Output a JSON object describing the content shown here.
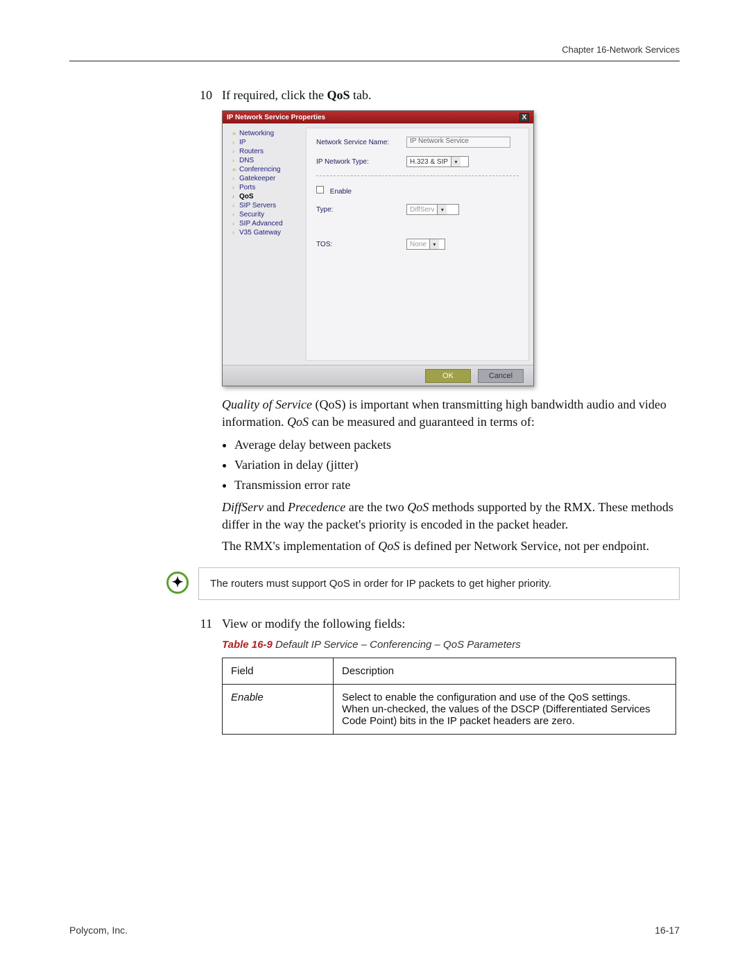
{
  "header": {
    "chapter": "Chapter 16-Network Services"
  },
  "step10": {
    "num": "10",
    "text_pre": "If required, click the ",
    "text_bold": "QoS",
    "text_post": " tab."
  },
  "dialog": {
    "title": "IP Network Service Properties",
    "close": "X",
    "nav": [
      {
        "label": "Networking",
        "chev": "»",
        "sel": false
      },
      {
        "label": "IP",
        "chev": "›",
        "sel": false
      },
      {
        "label": "Routers",
        "chev": "›",
        "sel": false
      },
      {
        "label": "DNS",
        "chev": "›",
        "sel": false
      },
      {
        "label": "Conferencing",
        "chev": "»",
        "sel": false
      },
      {
        "label": "Gatekeeper",
        "chev": "›",
        "sel": false
      },
      {
        "label": "Ports",
        "chev": "›",
        "sel": false
      },
      {
        "label": "QoS",
        "chev": "›",
        "sel": true
      },
      {
        "label": "SIP Servers",
        "chev": "›",
        "sel": false
      },
      {
        "label": "Security",
        "chev": "›",
        "sel": false
      },
      {
        "label": "SIP Advanced",
        "chev": "›",
        "sel": false
      },
      {
        "label": "V35 Gateway",
        "chev": "›",
        "sel": false
      }
    ],
    "fields": {
      "svc_name_label": "Network Service Name:",
      "svc_name_value": "IP Network Service",
      "net_type_label": "IP Network Type:",
      "net_type_value": "H.323 & SIP",
      "enable_label": "Enable",
      "type_label": "Type:",
      "type_value": "DiffServ",
      "tos_label": "TOS:",
      "tos_value": "None"
    },
    "buttons": {
      "ok": "OK",
      "cancel": "Cancel"
    }
  },
  "body": {
    "para1_pre_i": "Quality of Service",
    "para1_mid1": " (QoS) is important when transmitting high bandwidth audio and video information. ",
    "para1_i2": "QoS",
    "para1_post": " can be measured and guaranteed in terms of:",
    "bullets": [
      "Average delay between packets",
      "Variation in delay (jitter)",
      "Transmission error rate"
    ],
    "para2_i1": "DiffServ",
    "para2_mid1": " and ",
    "para2_i2": "Precedence",
    "para2_mid2": " are the two ",
    "para2_i3": "QoS",
    "para2_post": " methods supported by the RMX. These methods differ in the way the packet's priority is encoded in the packet header.",
    "para3_pre": "The RMX's implementation of ",
    "para3_i": "QoS",
    "para3_post": " is defined per Network Service, not per endpoint."
  },
  "note": {
    "text": "The routers must support QoS in order for IP packets to get higher priority."
  },
  "step11": {
    "num": "11",
    "text": "View or modify the following fields:"
  },
  "table": {
    "caption_num": "Table 16-9",
    "caption_title": "  Default IP Service – Conferencing – QoS Parameters",
    "head_field": "Field",
    "head_desc": "Description",
    "rows": [
      {
        "field": "Enable",
        "desc": "Select to enable the configuration and use of the QoS settings.\nWhen un-checked, the values of the DSCP (Differentiated Services Code Point) bits in the IP packet headers are zero."
      }
    ]
  },
  "footer": {
    "left": "Polycom, Inc.",
    "right": "16-17"
  }
}
